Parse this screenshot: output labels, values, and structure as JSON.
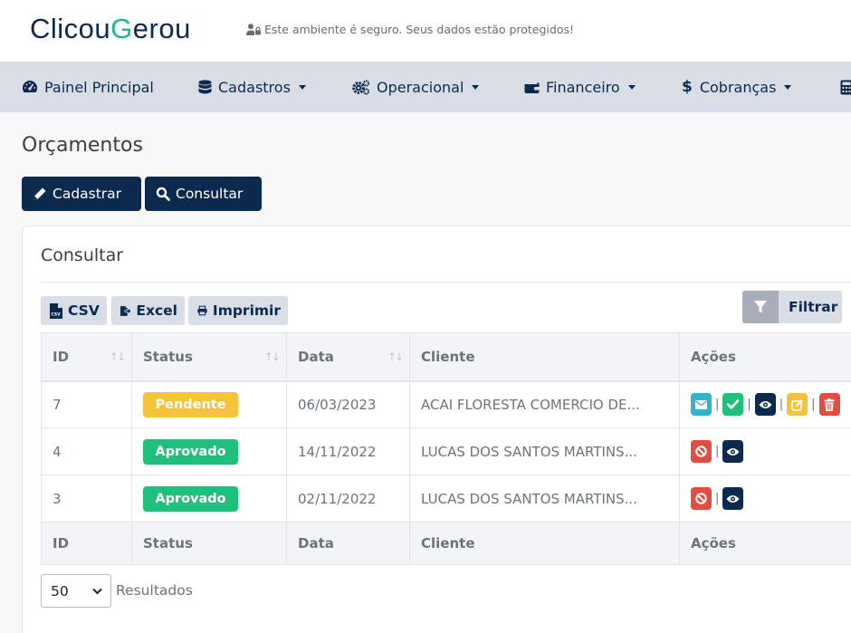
{
  "header": {
    "logo_left": "Clicou",
    "logo_mid": "G",
    "logo_right": "erou",
    "secure_text": "Este ambiente é seguro. Seus dados estão protegidos!"
  },
  "nav": {
    "items": [
      {
        "label": "Painel Principal",
        "icon": "gauge-icon"
      },
      {
        "label": "Cadastros",
        "icon": "database-icon"
      },
      {
        "label": "Operacional",
        "icon": "cogs-icon"
      },
      {
        "label": "Financeiro",
        "icon": "wallet-icon"
      },
      {
        "label": "Cobranças",
        "icon": "dollar-icon"
      }
    ]
  },
  "page": {
    "title": "Orçamentos",
    "cadastrar_label": "Cadastrar",
    "consultar_label": "Consultar"
  },
  "card": {
    "title": "Consultar",
    "csv_label": "CSV",
    "excel_label": "Excel",
    "print_label": "Imprimir",
    "filter_label": "Filtrar"
  },
  "table": {
    "columns": [
      "ID",
      "Status",
      "Data",
      "Cliente",
      "Ações"
    ],
    "rows": [
      {
        "id": "7",
        "status": "Pendente",
        "date": "06/03/2023",
        "client": "ACAI FLORESTA COMERCIO DE..."
      },
      {
        "id": "4",
        "status": "Aprovado",
        "date": "14/11/2022",
        "client": "LUCAS DOS SANTOS MARTINS..."
      },
      {
        "id": "3",
        "status": "Aprovado",
        "date": "02/11/2022",
        "client": "LUCAS DOS SANTOS MARTINS..."
      }
    ]
  },
  "pagination": {
    "page_size": "50",
    "results_label": "Resultados"
  },
  "colors": {
    "navy": "#0c2a4d",
    "pending": "#f5c33b",
    "approved": "#20c07c",
    "info": "#34b3d0",
    "danger": "#e14d3e"
  }
}
